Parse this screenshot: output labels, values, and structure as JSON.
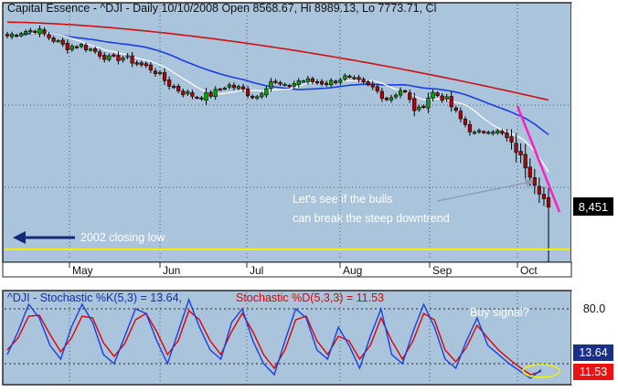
{
  "price_panel": {
    "title": "Capital Essence - ^DJI - Daily 10/10/2008 Open 8568.67, Hi 8989.13, Lo 7773.71, Cl",
    "last_price_label": "8,451",
    "annotation_1": "Let's see if the bulls",
    "annotation_2": "can break the steep downtrend",
    "low_label": "2002 closing low",
    "months": [
      "May",
      "Jun",
      "Jul",
      "Aug",
      "Sep",
      "Oct"
    ]
  },
  "stoch_panel": {
    "title_k": "^DJI - Stochastic %K(5,3) = 13.64,",
    "title_d": "Stochastic %D(5,3,3) = 11.53",
    "level_label": "80.0",
    "buy_signal_label": "Buy signal?",
    "k_value_label": "13.64",
    "d_value_label": "11.53"
  },
  "colors": {
    "panel_bg": "#aac4dc",
    "frame": "#2a2a2a",
    "candle_up": "#00a000",
    "candle_down": "#b00000",
    "ma_fast": "#ffffff",
    "ma_mid": "#1a3fe0",
    "ma_slow": "#d01010",
    "trendline": "#ff20c0",
    "support_line": "#f5f200",
    "stoch_k": "#1a3fe0",
    "stoch_d": "#e00000",
    "label_k_bg": "#1a2f8a",
    "label_d_bg": "#ee1111",
    "annotation_text": "#ffffff"
  },
  "chart_data": [
    {
      "type": "candlestick",
      "title": "Capital Essence - ^DJI - Daily 10/10/2008 Open 8568.67, Hi 8989.13, Lo 7773.71, Cl",
      "x": [
        "May",
        "Jun",
        "Jul",
        "Aug",
        "Sep",
        "Oct"
      ],
      "close_path": [
        12850,
        12960,
        13010,
        12780,
        12560,
        12610,
        12450,
        12250,
        12300,
        12120,
        11980,
        11620,
        11400,
        11280,
        11350,
        11590,
        11480,
        11260,
        11700,
        11520,
        11710,
        11670,
        11640,
        11790,
        11650,
        11510,
        11220,
        11500,
        10860,
        11400,
        11220,
        10700,
        10300,
        10480,
        10280,
        9800,
        9120,
        8450
      ],
      "last_price": 8451,
      "support_line_value": 7286,
      "indicators": [
        "moving average (fast)",
        "moving average (mid)",
        "moving average (slow)"
      ]
    },
    {
      "type": "line",
      "title": "^DJI - Stochastic %K(5,3) = 13.64, Stochastic %D(5,3,3) = 11.53",
      "series": [
        {
          "name": "Stochastic %K(5,3)",
          "values": [
            30,
            55,
            85,
            70,
            40,
            25,
            60,
            85,
            65,
            30,
            20,
            50,
            80,
            75,
            45,
            20,
            55,
            90,
            60,
            35,
            25,
            65,
            80,
            45,
            20,
            8,
            45,
            80,
            70,
            35,
            25,
            60,
            40,
            15,
            50,
            80,
            30,
            20,
            55,
            85,
            60,
            25,
            15,
            45,
            70,
            40,
            30,
            20,
            12,
            4,
            13.64
          ]
        },
        {
          "name": "Stochastic %D(5,3,3)",
          "values": [
            35,
            48,
            72,
            73,
            52,
            33,
            48,
            72,
            70,
            43,
            28,
            42,
            68,
            75,
            55,
            30,
            45,
            78,
            68,
            45,
            30,
            55,
            75,
            55,
            30,
            15,
            35,
            68,
            72,
            45,
            30,
            50,
            45,
            25,
            40,
            70,
            45,
            25,
            45,
            75,
            68,
            35,
            22,
            38,
            62,
            48,
            35,
            25,
            16,
            8,
            11.53
          ]
        }
      ],
      "ylabel_ticks": [
        "80.0"
      ],
      "last_k": 13.64,
      "last_d": 11.53
    }
  ]
}
